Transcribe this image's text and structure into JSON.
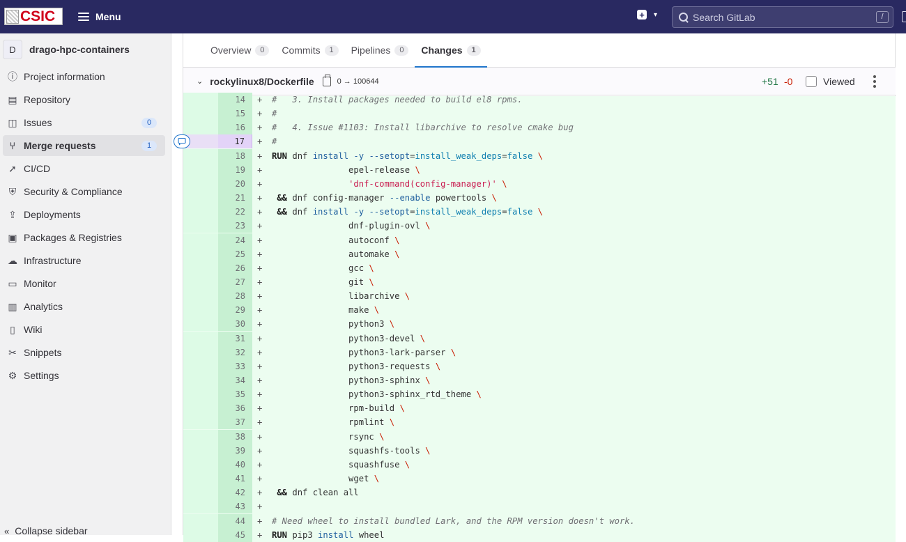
{
  "topbar": {
    "logo_text": "CSIC",
    "menu_label": "Menu",
    "search_placeholder": "Search GitLab",
    "search_shortcut": "/"
  },
  "sidebar": {
    "project_initial": "D",
    "project_name": "drago-hpc-containers",
    "items": [
      {
        "label": "Project information",
        "icon": "info-icon"
      },
      {
        "label": "Repository",
        "icon": "document-icon"
      },
      {
        "label": "Issues",
        "icon": "issues-icon",
        "badge": "0"
      },
      {
        "label": "Merge requests",
        "icon": "merge-request-icon",
        "badge": "1",
        "active": true
      },
      {
        "label": "CI/CD",
        "icon": "rocket-icon"
      },
      {
        "label": "Security & Compliance",
        "icon": "shield-icon"
      },
      {
        "label": "Deployments",
        "icon": "deployments-icon"
      },
      {
        "label": "Packages & Registries",
        "icon": "package-icon"
      },
      {
        "label": "Infrastructure",
        "icon": "cloud-gear-icon"
      },
      {
        "label": "Monitor",
        "icon": "monitor-icon"
      },
      {
        "label": "Analytics",
        "icon": "chart-icon"
      },
      {
        "label": "Wiki",
        "icon": "book-icon"
      },
      {
        "label": "Snippets",
        "icon": "snippet-icon"
      },
      {
        "label": "Settings",
        "icon": "settings-icon"
      }
    ],
    "collapse_label": "Collapse sidebar"
  },
  "tabs": [
    {
      "label": "Overview",
      "count": "0"
    },
    {
      "label": "Commits",
      "count": "1"
    },
    {
      "label": "Pipelines",
      "count": "0"
    },
    {
      "label": "Changes",
      "count": "1",
      "active": true
    }
  ],
  "file": {
    "path": "rockylinux8/Dockerfile",
    "mode_change": "0 → 100644",
    "additions": "+51",
    "deletions": "-0",
    "viewed_label": "Viewed"
  },
  "diff_lines": [
    {
      "n": "14",
      "text": "#   3. Install packages needed to build el8 rpms."
    },
    {
      "n": "15",
      "text": "#"
    },
    {
      "n": "16",
      "text": "#   4. Issue #1103: Install libarchive to resolve cmake bug"
    },
    {
      "n": "17",
      "text": "#"
    },
    {
      "n": "18",
      "text": "RUN dnf install -y --setopt=install_weak_deps=false \\"
    },
    {
      "n": "19",
      "text": "               epel-release \\"
    },
    {
      "n": "20",
      "text": "               'dnf-command(config-manager)' \\"
    },
    {
      "n": "21",
      "text": " && dnf config-manager --enable powertools \\"
    },
    {
      "n": "22",
      "text": " && dnf install -y --setopt=install_weak_deps=false \\"
    },
    {
      "n": "23",
      "text": "               dnf-plugin-ovl \\"
    },
    {
      "n": "24",
      "text": "               autoconf \\"
    },
    {
      "n": "25",
      "text": "               automake \\"
    },
    {
      "n": "26",
      "text": "               gcc \\"
    },
    {
      "n": "27",
      "text": "               git \\"
    },
    {
      "n": "28",
      "text": "               libarchive \\"
    },
    {
      "n": "29",
      "text": "               make \\"
    },
    {
      "n": "30",
      "text": "               python3 \\"
    },
    {
      "n": "31",
      "text": "               python3-devel \\"
    },
    {
      "n": "32",
      "text": "               python3-lark-parser \\"
    },
    {
      "n": "33",
      "text": "               python3-requests \\"
    },
    {
      "n": "34",
      "text": "               python3-sphinx \\"
    },
    {
      "n": "35",
      "text": "               python3-sphinx_rtd_theme \\"
    },
    {
      "n": "36",
      "text": "               rpm-build \\"
    },
    {
      "n": "37",
      "text": "               rpmlint \\"
    },
    {
      "n": "38",
      "text": "               rsync \\"
    },
    {
      "n": "39",
      "text": "               squashfs-tools \\"
    },
    {
      "n": "40",
      "text": "               squashfuse \\"
    },
    {
      "n": "41",
      "text": "               wget \\"
    },
    {
      "n": "42",
      "text": " && dnf clean all"
    },
    {
      "n": "43",
      "text": ""
    },
    {
      "n": "44",
      "text": "# Need wheel to install bundled Lark, and the RPM version doesn't work."
    },
    {
      "n": "45",
      "text": "RUN pip3 install wheel"
    }
  ],
  "highlighted_line": "17"
}
